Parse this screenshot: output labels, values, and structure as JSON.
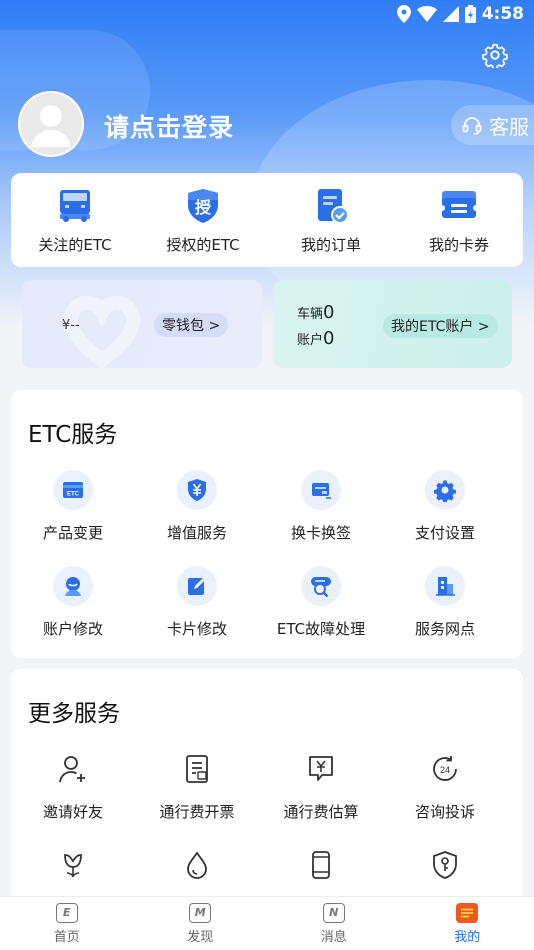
{
  "status_bar": {
    "time": "4:58"
  },
  "profile": {
    "login_prompt": "请点击登录",
    "customer_service": "客服"
  },
  "quick_actions": [
    {
      "label": "关注的ETC",
      "icon": "truck-icon"
    },
    {
      "label": "授权的ETC",
      "icon": "authorize-shield-icon",
      "glyph": "授"
    },
    {
      "label": "我的订单",
      "icon": "order-check-icon"
    },
    {
      "label": "我的卡券",
      "icon": "coupon-icon"
    }
  ],
  "wallet": {
    "amount": "¥--",
    "label": "零钱包",
    "arrow": ">"
  },
  "etc_account": {
    "vehicles_label": "车辆",
    "vehicles_count": "0",
    "account_label": "账户",
    "account_count": "0",
    "label": "我的ETC账户",
    "arrow": ">"
  },
  "etc_services": {
    "title": "ETC服务",
    "items": [
      {
        "label": "产品变更",
        "icon": "etc-card-icon"
      },
      {
        "label": "增值服务",
        "icon": "yen-shield-icon"
      },
      {
        "label": "换卡换签",
        "icon": "card-swap-icon"
      },
      {
        "label": "支付设置",
        "icon": "gear-icon"
      },
      {
        "label": "账户修改",
        "icon": "user-edit-icon"
      },
      {
        "label": "卡片修改",
        "icon": "edit-icon"
      },
      {
        "label": "ETC故障处理",
        "icon": "diagnose-icon"
      },
      {
        "label": "服务网点",
        "icon": "building-icon"
      }
    ]
  },
  "more_services": {
    "title": "更多服务",
    "items": [
      {
        "label": "邀请好友",
        "icon": "add-user-icon"
      },
      {
        "label": "通行费开票",
        "icon": "invoice-icon"
      },
      {
        "label": "通行费估算",
        "icon": "yen-estimate-icon"
      },
      {
        "label": "咨询投诉",
        "icon": "24h-icon"
      },
      {
        "label": "",
        "icon": "flower-icon"
      },
      {
        "label": "",
        "icon": "drop-icon"
      },
      {
        "label": "",
        "icon": "phone-icon"
      },
      {
        "label": "",
        "icon": "shield-key-icon"
      }
    ]
  },
  "tabbar": [
    {
      "label": "首页",
      "glyph": "E"
    },
    {
      "label": "发现",
      "glyph": "M"
    },
    {
      "label": "消息",
      "glyph": "N"
    },
    {
      "label": "我的",
      "glyph": "",
      "active": true
    }
  ],
  "colors": {
    "primary": "#1f72f0",
    "accent_orange": "#ee5a1e"
  }
}
